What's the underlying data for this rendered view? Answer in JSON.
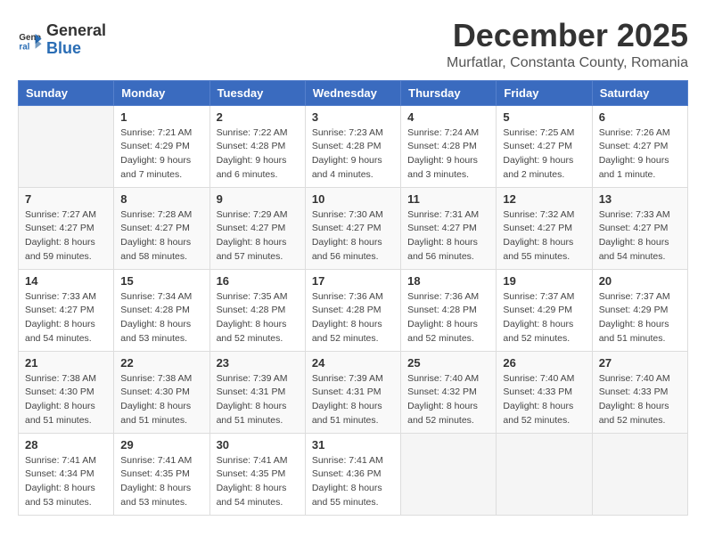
{
  "header": {
    "month": "December 2025",
    "location": "Murfatlar, Constanta County, Romania",
    "logo_line1": "General",
    "logo_line2": "Blue"
  },
  "weekdays": [
    "Sunday",
    "Monday",
    "Tuesday",
    "Wednesday",
    "Thursday",
    "Friday",
    "Saturday"
  ],
  "rows": [
    [
      {
        "day": "",
        "sunrise": "",
        "sunset": "",
        "daylight": ""
      },
      {
        "day": "1",
        "sunrise": "Sunrise: 7:21 AM",
        "sunset": "Sunset: 4:29 PM",
        "daylight": "Daylight: 9 hours and 7 minutes."
      },
      {
        "day": "2",
        "sunrise": "Sunrise: 7:22 AM",
        "sunset": "Sunset: 4:28 PM",
        "daylight": "Daylight: 9 hours and 6 minutes."
      },
      {
        "day": "3",
        "sunrise": "Sunrise: 7:23 AM",
        "sunset": "Sunset: 4:28 PM",
        "daylight": "Daylight: 9 hours and 4 minutes."
      },
      {
        "day": "4",
        "sunrise": "Sunrise: 7:24 AM",
        "sunset": "Sunset: 4:28 PM",
        "daylight": "Daylight: 9 hours and 3 minutes."
      },
      {
        "day": "5",
        "sunrise": "Sunrise: 7:25 AM",
        "sunset": "Sunset: 4:27 PM",
        "daylight": "Daylight: 9 hours and 2 minutes."
      },
      {
        "day": "6",
        "sunrise": "Sunrise: 7:26 AM",
        "sunset": "Sunset: 4:27 PM",
        "daylight": "Daylight: 9 hours and 1 minute."
      }
    ],
    [
      {
        "day": "7",
        "sunrise": "Sunrise: 7:27 AM",
        "sunset": "Sunset: 4:27 PM",
        "daylight": "Daylight: 8 hours and 59 minutes."
      },
      {
        "day": "8",
        "sunrise": "Sunrise: 7:28 AM",
        "sunset": "Sunset: 4:27 PM",
        "daylight": "Daylight: 8 hours and 58 minutes."
      },
      {
        "day": "9",
        "sunrise": "Sunrise: 7:29 AM",
        "sunset": "Sunset: 4:27 PM",
        "daylight": "Daylight: 8 hours and 57 minutes."
      },
      {
        "day": "10",
        "sunrise": "Sunrise: 7:30 AM",
        "sunset": "Sunset: 4:27 PM",
        "daylight": "Daylight: 8 hours and 56 minutes."
      },
      {
        "day": "11",
        "sunrise": "Sunrise: 7:31 AM",
        "sunset": "Sunset: 4:27 PM",
        "daylight": "Daylight: 8 hours and 56 minutes."
      },
      {
        "day": "12",
        "sunrise": "Sunrise: 7:32 AM",
        "sunset": "Sunset: 4:27 PM",
        "daylight": "Daylight: 8 hours and 55 minutes."
      },
      {
        "day": "13",
        "sunrise": "Sunrise: 7:33 AM",
        "sunset": "Sunset: 4:27 PM",
        "daylight": "Daylight: 8 hours and 54 minutes."
      }
    ],
    [
      {
        "day": "14",
        "sunrise": "Sunrise: 7:33 AM",
        "sunset": "Sunset: 4:27 PM",
        "daylight": "Daylight: 8 hours and 54 minutes."
      },
      {
        "day": "15",
        "sunrise": "Sunrise: 7:34 AM",
        "sunset": "Sunset: 4:28 PM",
        "daylight": "Daylight: 8 hours and 53 minutes."
      },
      {
        "day": "16",
        "sunrise": "Sunrise: 7:35 AM",
        "sunset": "Sunset: 4:28 PM",
        "daylight": "Daylight: 8 hours and 52 minutes."
      },
      {
        "day": "17",
        "sunrise": "Sunrise: 7:36 AM",
        "sunset": "Sunset: 4:28 PM",
        "daylight": "Daylight: 8 hours and 52 minutes."
      },
      {
        "day": "18",
        "sunrise": "Sunrise: 7:36 AM",
        "sunset": "Sunset: 4:28 PM",
        "daylight": "Daylight: 8 hours and 52 minutes."
      },
      {
        "day": "19",
        "sunrise": "Sunrise: 7:37 AM",
        "sunset": "Sunset: 4:29 PM",
        "daylight": "Daylight: 8 hours and 52 minutes."
      },
      {
        "day": "20",
        "sunrise": "Sunrise: 7:37 AM",
        "sunset": "Sunset: 4:29 PM",
        "daylight": "Daylight: 8 hours and 51 minutes."
      }
    ],
    [
      {
        "day": "21",
        "sunrise": "Sunrise: 7:38 AM",
        "sunset": "Sunset: 4:30 PM",
        "daylight": "Daylight: 8 hours and 51 minutes."
      },
      {
        "day": "22",
        "sunrise": "Sunrise: 7:38 AM",
        "sunset": "Sunset: 4:30 PM",
        "daylight": "Daylight: 8 hours and 51 minutes."
      },
      {
        "day": "23",
        "sunrise": "Sunrise: 7:39 AM",
        "sunset": "Sunset: 4:31 PM",
        "daylight": "Daylight: 8 hours and 51 minutes."
      },
      {
        "day": "24",
        "sunrise": "Sunrise: 7:39 AM",
        "sunset": "Sunset: 4:31 PM",
        "daylight": "Daylight: 8 hours and 51 minutes."
      },
      {
        "day": "25",
        "sunrise": "Sunrise: 7:40 AM",
        "sunset": "Sunset: 4:32 PM",
        "daylight": "Daylight: 8 hours and 52 minutes."
      },
      {
        "day": "26",
        "sunrise": "Sunrise: 7:40 AM",
        "sunset": "Sunset: 4:33 PM",
        "daylight": "Daylight: 8 hours and 52 minutes."
      },
      {
        "day": "27",
        "sunrise": "Sunrise: 7:40 AM",
        "sunset": "Sunset: 4:33 PM",
        "daylight": "Daylight: 8 hours and 52 minutes."
      }
    ],
    [
      {
        "day": "28",
        "sunrise": "Sunrise: 7:41 AM",
        "sunset": "Sunset: 4:34 PM",
        "daylight": "Daylight: 8 hours and 53 minutes."
      },
      {
        "day": "29",
        "sunrise": "Sunrise: 7:41 AM",
        "sunset": "Sunset: 4:35 PM",
        "daylight": "Daylight: 8 hours and 53 minutes."
      },
      {
        "day": "30",
        "sunrise": "Sunrise: 7:41 AM",
        "sunset": "Sunset: 4:35 PM",
        "daylight": "Daylight: 8 hours and 54 minutes."
      },
      {
        "day": "31",
        "sunrise": "Sunrise: 7:41 AM",
        "sunset": "Sunset: 4:36 PM",
        "daylight": "Daylight: 8 hours and 55 minutes."
      },
      {
        "day": "",
        "sunrise": "",
        "sunset": "",
        "daylight": ""
      },
      {
        "day": "",
        "sunrise": "",
        "sunset": "",
        "daylight": ""
      },
      {
        "day": "",
        "sunrise": "",
        "sunset": "",
        "daylight": ""
      }
    ]
  ]
}
